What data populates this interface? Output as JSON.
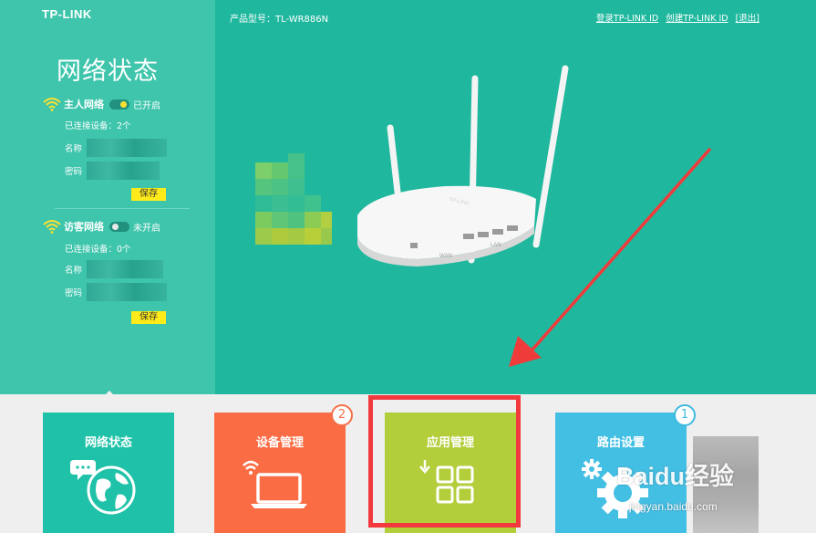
{
  "header": {
    "logo": "TP-LINK",
    "model": "产品型号：TL-WR886N",
    "login_link": "登录TP-LINK ID",
    "create_link": "创建TP-LINK ID",
    "exit_link": "[退出]"
  },
  "status_panel": {
    "title": "网络状态",
    "host_network": {
      "name": "主人网络",
      "state": "已开启",
      "devices": "已连接设备：2个",
      "name_label": "名称",
      "password_label": "密码",
      "save": "保存"
    },
    "guest_network": {
      "name": "访客网络",
      "state": "未开启",
      "devices": "已连接设备：0个",
      "name_label": "名称",
      "password_label": "密码",
      "save": "保存"
    }
  },
  "router_labels": {
    "brand": "TP-LINK",
    "wan": "WAN",
    "lan": "LAN"
  },
  "tiles": [
    {
      "label": "网络状态",
      "icon": "globe-chat-icon",
      "color": "#1fc2a8"
    },
    {
      "label": "设备管理",
      "icon": "laptop-wifi-icon",
      "color": "#fa6c43",
      "badge": "2"
    },
    {
      "label": "应用管理",
      "icon": "apps-grid-icon",
      "color": "#b2ce3b"
    },
    {
      "label": "路由设置",
      "icon": "gear-icon",
      "color": "#44bfe4",
      "badge": "1"
    }
  ],
  "watermark": {
    "brand": "Baidu经验",
    "url": "jingyan.baidu.com"
  },
  "colors": {
    "teal": "#1fb89e",
    "panel": "#3ec5ac",
    "highlight": "#f23a3e",
    "save_button": "#ffeb1a"
  }
}
